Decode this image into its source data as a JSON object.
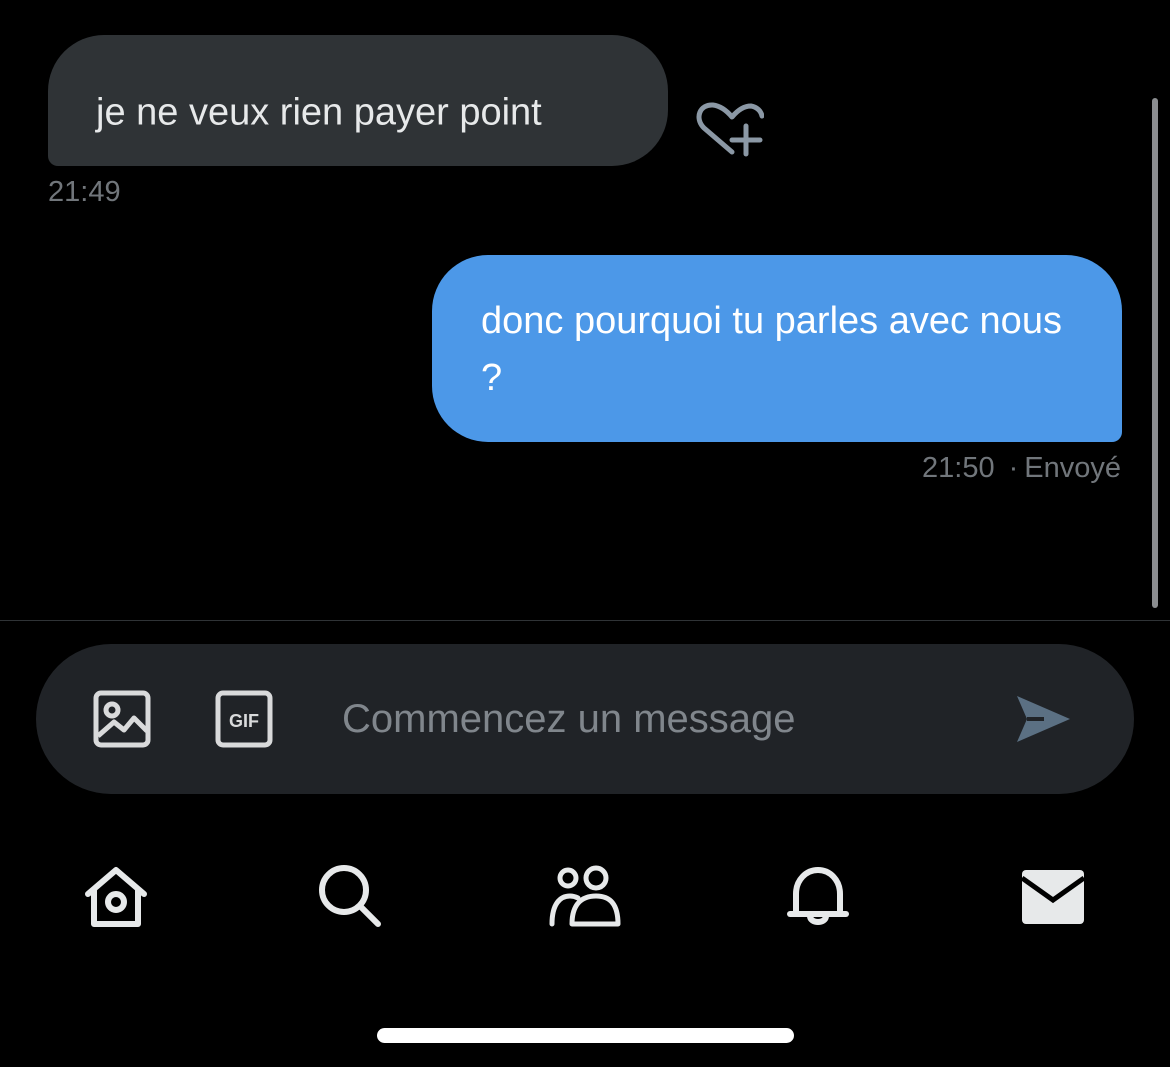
{
  "messages": [
    {
      "direction": "received",
      "text": "je ne veux rien payer point",
      "time": "21:49"
    },
    {
      "direction": "sent",
      "text": "donc pourquoi tu parles avec nous ?",
      "time": "21:50",
      "status": "Envoyé"
    }
  ],
  "reaction_icon": "heart-plus-icon",
  "composer": {
    "placeholder": "Commencez un message",
    "value": "",
    "media_icon": "image-icon",
    "gif_label": "GIF",
    "send_icon": "send-icon"
  },
  "nav": {
    "items": [
      "home-icon",
      "search-icon",
      "communities-icon",
      "notifications-icon",
      "messages-icon"
    ],
    "active": "messages-icon"
  },
  "colors": {
    "background": "#000000",
    "received_bubble": "#2f3336",
    "sent_bubble": "#4c98e8",
    "muted_text": "#71767b",
    "composer": "#202327"
  }
}
